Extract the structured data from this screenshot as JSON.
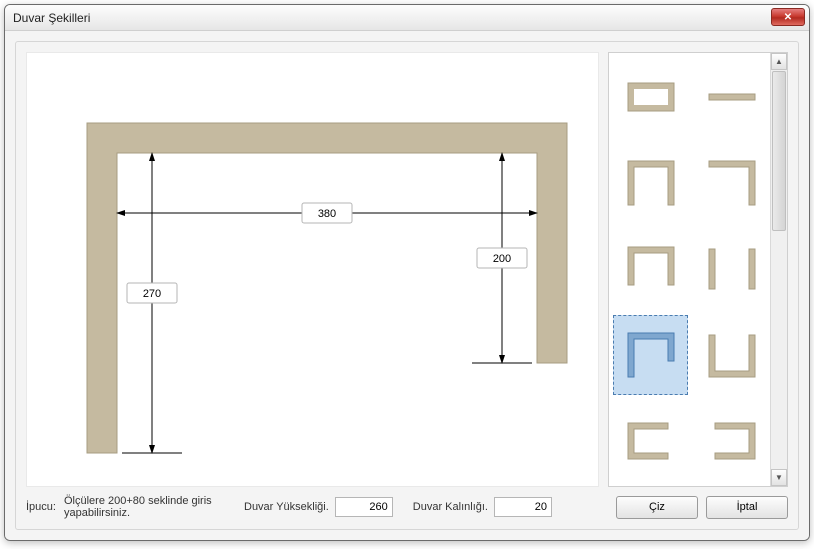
{
  "window": {
    "title": "Duvar Şekilleri",
    "close": "✕"
  },
  "preview": {
    "dim_width": "380",
    "dim_left_height": "270",
    "dim_right_height": "200"
  },
  "chart_data": {
    "type": "diagram",
    "description": "Wall shape with top beam and two legs of unequal height",
    "inner_width": 380,
    "left_leg_height": 270,
    "right_leg_height": 200,
    "wall_thickness": 20
  },
  "shapes": {
    "items": [
      {
        "name": "rectangle-closed",
        "selected": false
      },
      {
        "name": "top-bar",
        "selected": false
      },
      {
        "name": "open-bottom-wide",
        "selected": false
      },
      {
        "name": "corner-top-right",
        "selected": false
      },
      {
        "name": "open-bottom-narrow",
        "selected": false
      },
      {
        "name": "left-right-bars",
        "selected": false
      },
      {
        "name": "open-bottom-unequal",
        "selected": true
      },
      {
        "name": "u-shape",
        "selected": false
      },
      {
        "name": "c-open-right",
        "selected": false
      },
      {
        "name": "c-open-left",
        "selected": false
      }
    ]
  },
  "footer": {
    "hint_label": "İpucu:",
    "hint_text": "Ölçülere 200+80 seklinde giris yapabilirsiniz.",
    "height_label": "Duvar Yüksekliği.",
    "height_value": "260",
    "thickness_label": "Duvar Kalınlığı.",
    "thickness_value": "20",
    "draw_btn": "Çiz",
    "cancel_btn": "İptal"
  },
  "colors": {
    "wall_fill": "#c5baa0",
    "wall_stroke": "#a79c82",
    "selection": "#c7ddf2"
  }
}
